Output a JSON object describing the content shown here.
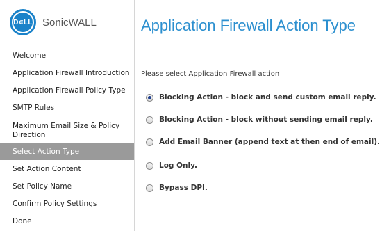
{
  "brand": {
    "logo_text": "D∊LL",
    "product": "SonicWALL"
  },
  "nav": {
    "items": [
      {
        "label": "Welcome",
        "active": false
      },
      {
        "label": "Application Firewall Introduction",
        "active": false
      },
      {
        "label": "Application Firewall Policy Type",
        "active": false
      },
      {
        "label": "SMTP Rules",
        "active": false
      },
      {
        "label": "Maximum Email Size & Policy Direction",
        "active": false
      },
      {
        "label": "Select Action Type",
        "active": true
      },
      {
        "label": "Set Action Content",
        "active": false
      },
      {
        "label": "Set Policy Name",
        "active": false
      },
      {
        "label": "Confirm Policy Settings",
        "active": false
      },
      {
        "label": "Done",
        "active": false
      }
    ]
  },
  "main": {
    "title": "Application Firewall Action Type",
    "prompt": "Please select Application Firewall action",
    "options": [
      {
        "label": "Blocking Action - block and send custom email reply.",
        "selected": true
      },
      {
        "label": "Blocking Action - block without sending email reply.",
        "selected": false
      },
      {
        "label": "Add Email Banner (append text at then end of email).",
        "selected": false
      },
      {
        "label": "Log Only.",
        "selected": false
      },
      {
        "label": "Bypass DPI.",
        "selected": false
      }
    ]
  },
  "colors": {
    "accent": "#2b8fcf",
    "nav_active_bg": "#9a9a9a",
    "dell_blue": "#1a82c9"
  }
}
